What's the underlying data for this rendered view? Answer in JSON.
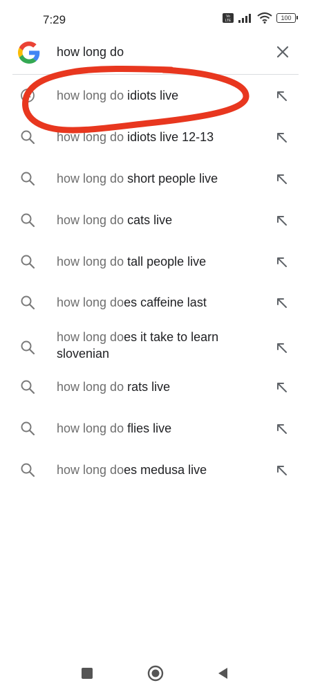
{
  "status": {
    "time": "7:29",
    "battery": "100"
  },
  "search": {
    "query": "how long do",
    "clear_icon": "close-icon",
    "logo": "google-g-logo"
  },
  "suggestions": [
    {
      "prefix": "how long do",
      "completion": " idiots live",
      "lead_icon": "history-icon"
    },
    {
      "prefix": "how long do",
      "completion": " idiots live 12-13",
      "lead_icon": "search-icon"
    },
    {
      "prefix": "how long do",
      "completion": " short people live",
      "lead_icon": "search-icon"
    },
    {
      "prefix": "how long do",
      "completion": " cats live",
      "lead_icon": "search-icon"
    },
    {
      "prefix": "how long do",
      "completion": " tall people live",
      "lead_icon": "search-icon"
    },
    {
      "prefix": "how long do",
      "completion": "es caffeine last",
      "lead_icon": "search-icon"
    },
    {
      "prefix": "how long do",
      "completion": "es it take to learn slovenian",
      "lead_icon": "search-icon"
    },
    {
      "prefix": "how long do",
      "completion": " rats live",
      "lead_icon": "search-icon"
    },
    {
      "prefix": "how long do",
      "completion": " flies live",
      "lead_icon": "search-icon"
    },
    {
      "prefix": "how long do",
      "completion": "es medusa live",
      "lead_icon": "search-icon"
    }
  ],
  "colors": {
    "annotation": "#e8371f",
    "google_blue": "#4285F4",
    "google_red": "#EA4335",
    "google_yellow": "#FBBC05",
    "google_green": "#34A853"
  }
}
